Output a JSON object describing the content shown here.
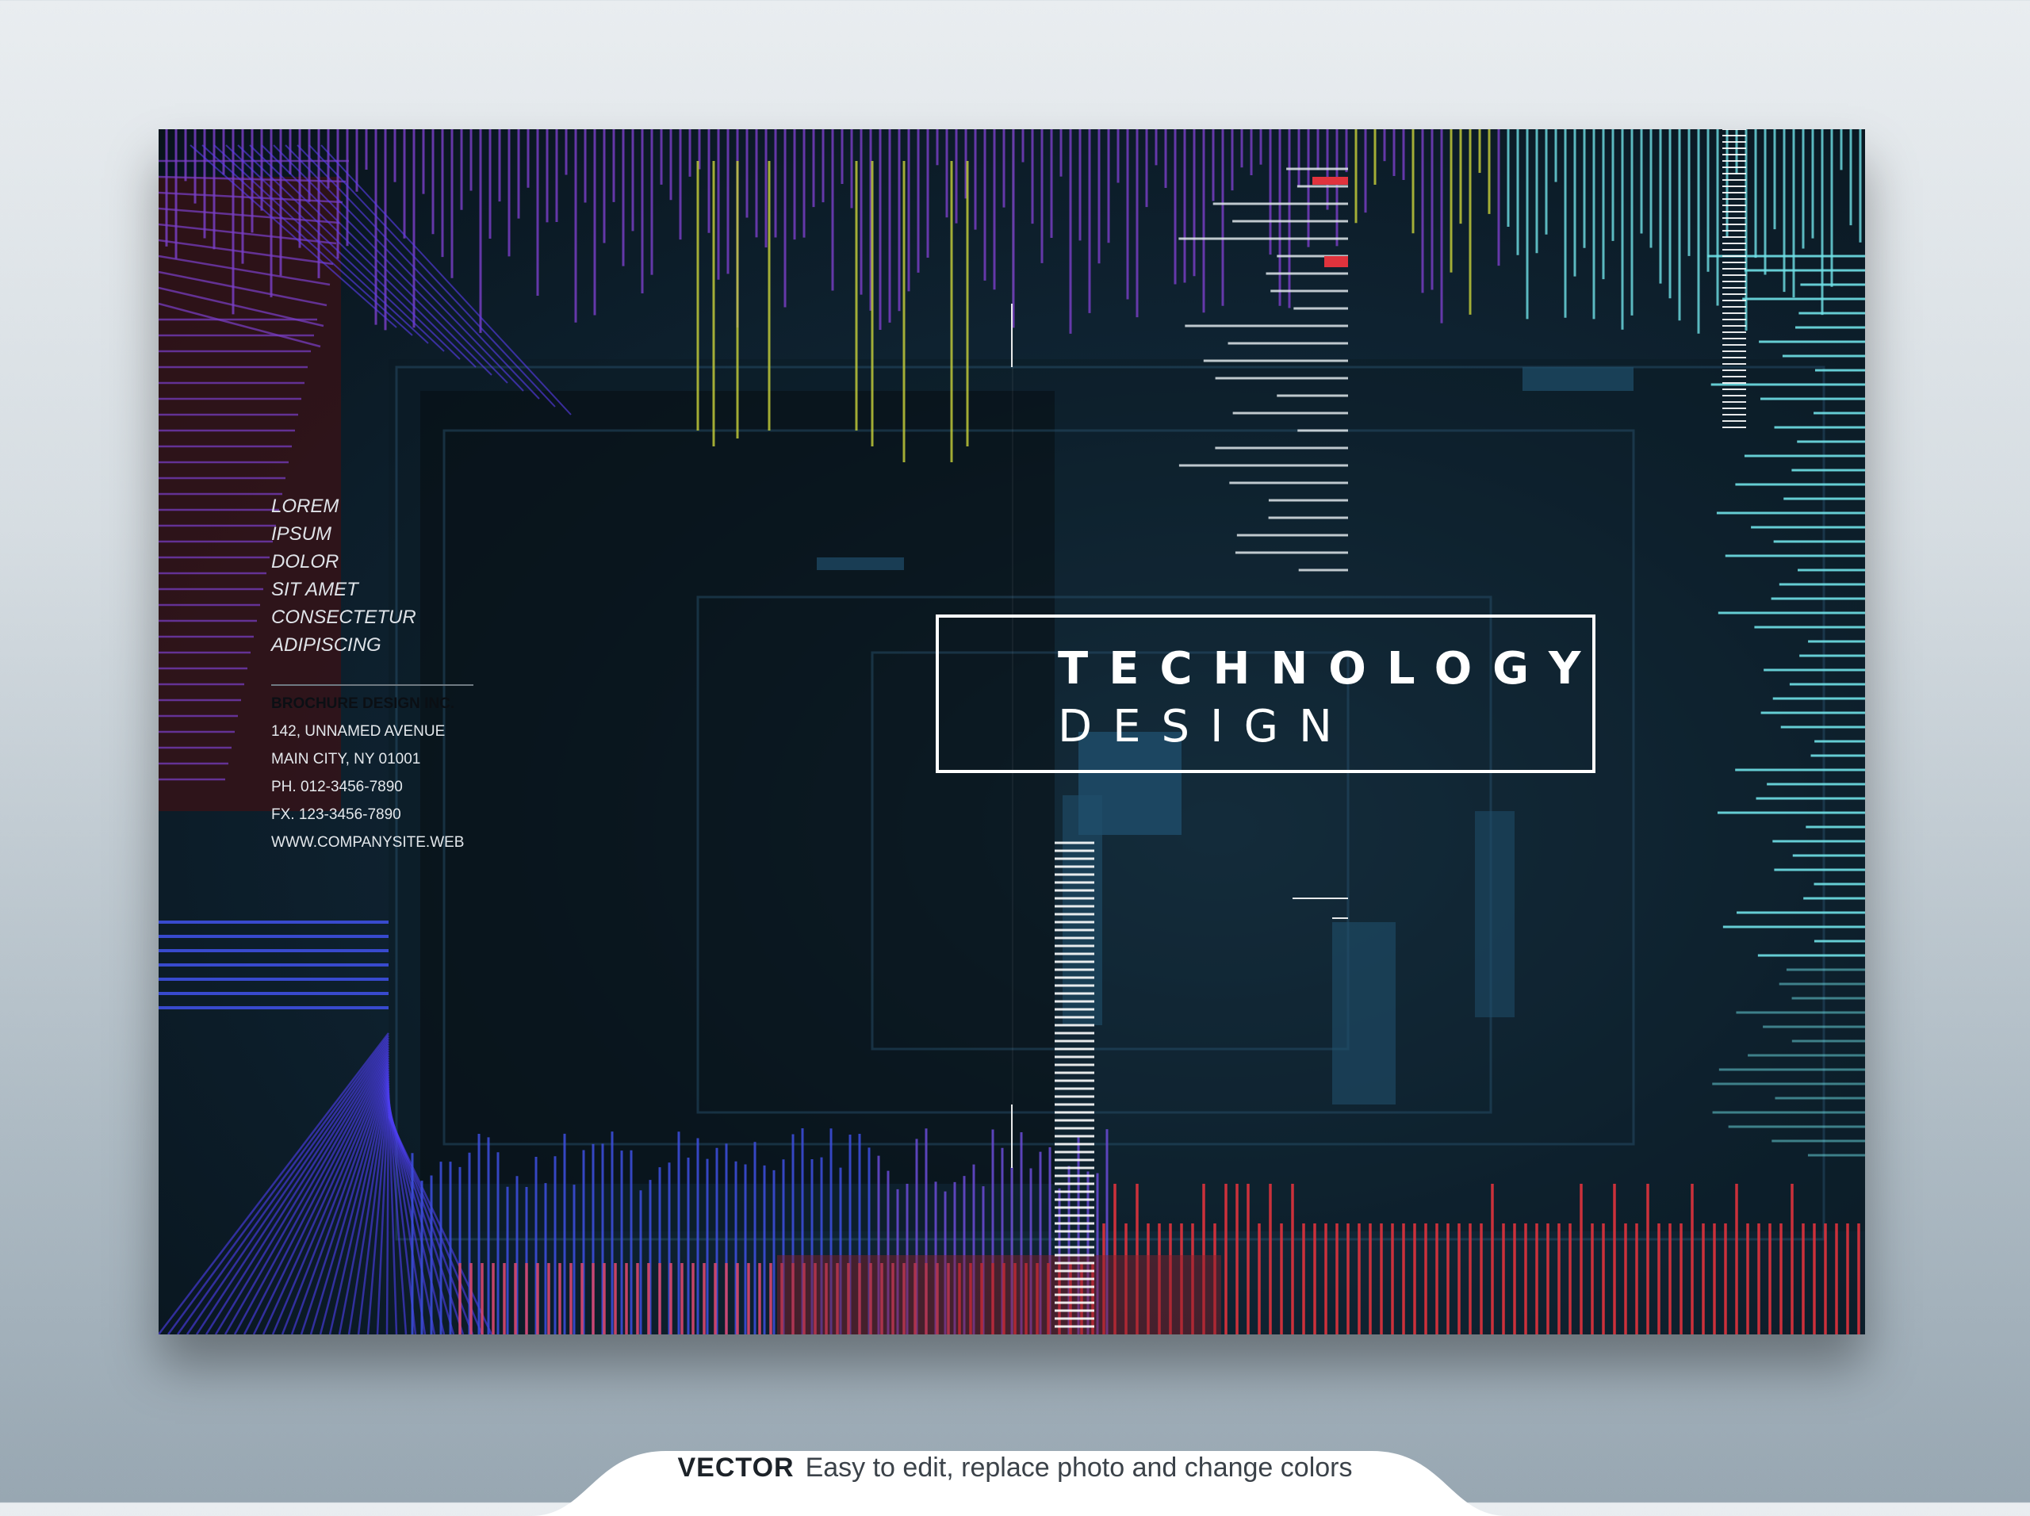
{
  "brochure": {
    "title": "TECHNOLOGY",
    "subtitle": "DESIGN",
    "tagline": [
      "LOREM",
      "IPSUM",
      "DOLOR",
      "SIT AMET",
      "CONSECTETUR",
      "ADIPISCING"
    ],
    "contact": {
      "company": "BROCHURE DESIGN INC.",
      "address": "142, UNNAMED AVENUE",
      "city": "MAIN CITY, NY 01001",
      "phone": "PH.  012-3456-7890",
      "fax": "FX.   123-3456-7890",
      "website": "WWW.COMPANYSITE.WEB"
    },
    "colors": {
      "background": "#0f2433",
      "purple_lines": "#7b3fc9",
      "blue_lines": "#3d4fe0",
      "cyan_lines": "#6fe0e6",
      "red_lines": "#e0333d",
      "yellow_lines": "#c9d23a",
      "white": "#ffffff"
    }
  },
  "footer": {
    "label": "VECTOR",
    "text": "Easy to edit, replace photo and change colors"
  }
}
